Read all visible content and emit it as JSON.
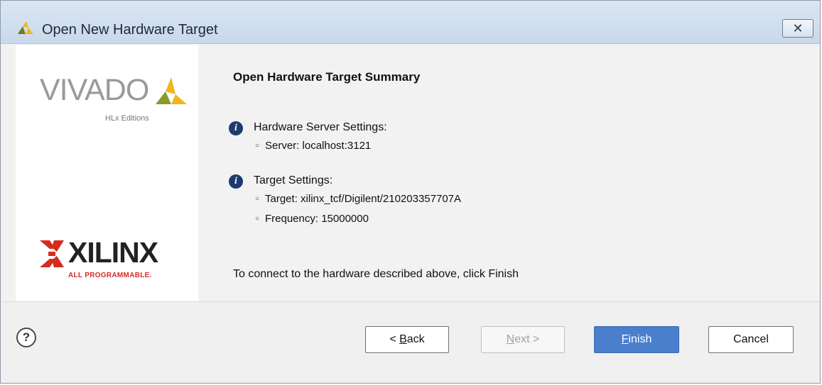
{
  "window": {
    "title": "Open New Hardware Target",
    "close_symbol": "✕"
  },
  "branding": {
    "vivado_logo_text": "VIVADO",
    "vivado_subtitle": "HLx Editions",
    "xilinx_logo_text": "XILINX",
    "xilinx_tagline": "ALL PROGRAMMABLE."
  },
  "summary": {
    "title": "Open Hardware Target Summary",
    "sections": [
      {
        "heading": "Hardware Server Settings:",
        "items": [
          "Server: localhost:3121"
        ]
      },
      {
        "heading": "Target Settings:",
        "items": [
          "Target: xilinx_tcf/Digilent/210203357707A",
          "Frequency: 15000000"
        ]
      }
    ],
    "instruction": "To connect to the hardware described above, click Finish"
  },
  "footer": {
    "help_symbol": "?",
    "back_prefix": "< ",
    "back_mnemonic": "B",
    "back_rest": "ack",
    "next_mnemonic": "N",
    "next_rest": "ext >",
    "finish_mnemonic": "F",
    "finish_rest": "inish",
    "cancel_label": "Cancel"
  },
  "colors": {
    "accent": "#4a7fce",
    "titlebar": "#c9d8ea",
    "info_icon": "#1f3b6e",
    "xilinx_red": "#d62b1f"
  },
  "icons": {
    "title": "vivado-leaf-icon",
    "info": "info-icon",
    "help": "help-icon",
    "close": "close-icon"
  }
}
